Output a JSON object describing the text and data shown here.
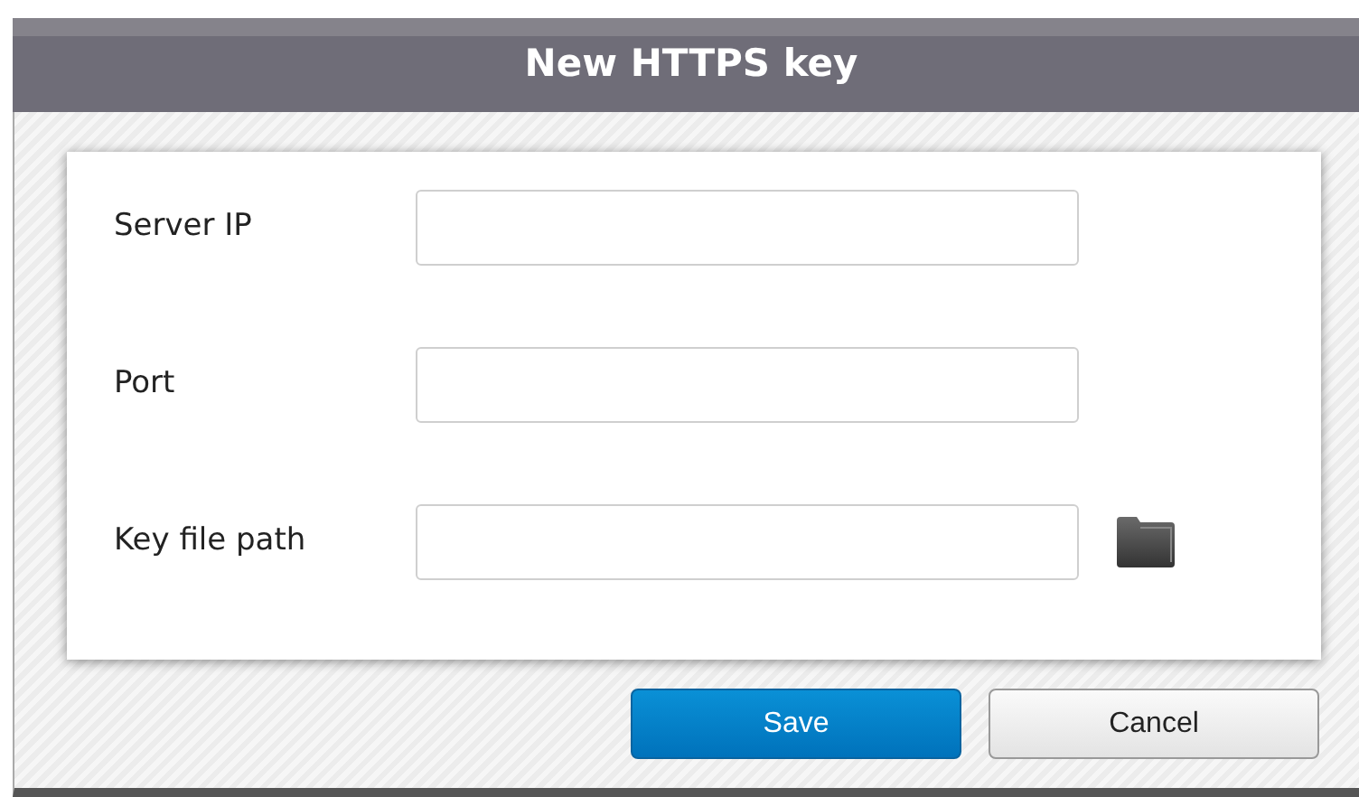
{
  "window": {
    "title": "New HTTPS key"
  },
  "fields": [
    {
      "label": "Server IP",
      "kind": "text"
    },
    {
      "label": "Port",
      "kind": "text"
    },
    {
      "label": "Key file path",
      "kind": "file"
    }
  ],
  "buttons": [
    {
      "label": "Save",
      "kind": "primary"
    },
    {
      "label": "Cancel",
      "kind": "secondary"
    }
  ]
}
